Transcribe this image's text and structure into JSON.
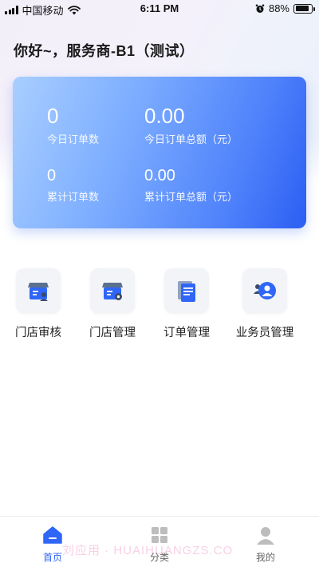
{
  "status_bar": {
    "carrier": "中国移动",
    "time": "6:11 PM",
    "battery_percent": "88%",
    "battery_level": 0.88
  },
  "header": {
    "greeting": "你好~，服务商-B1（测试）"
  },
  "stats": {
    "today_orders_value": "0",
    "today_orders_label": "今日订单数",
    "today_amount_value": "0.00",
    "today_amount_label": "今日订单总额（元）",
    "total_orders_value": "0",
    "total_orders_label": "累计订单数",
    "total_amount_value": "0.00",
    "total_amount_label": "累计订单总额（元）"
  },
  "menu": {
    "items": [
      {
        "label": "门店审核",
        "icon": "store-review-icon"
      },
      {
        "label": "门店管理",
        "icon": "store-manage-icon"
      },
      {
        "label": "订单管理",
        "icon": "order-document-icon"
      },
      {
        "label": "业务员管理",
        "icon": "salesperson-icon"
      }
    ]
  },
  "tabbar": {
    "tabs": [
      {
        "label": "首页",
        "icon": "home-icon",
        "active": true
      },
      {
        "label": "分类",
        "icon": "grid-icon",
        "active": false
      },
      {
        "label": "我的",
        "icon": "user-icon",
        "active": false
      }
    ]
  },
  "colors": {
    "accent": "#2f66f6",
    "card_start": "#a9cfff",
    "card_end": "#2c5ef3"
  },
  "watermark": "刘应用 · HUAIHUANGZS.CO"
}
